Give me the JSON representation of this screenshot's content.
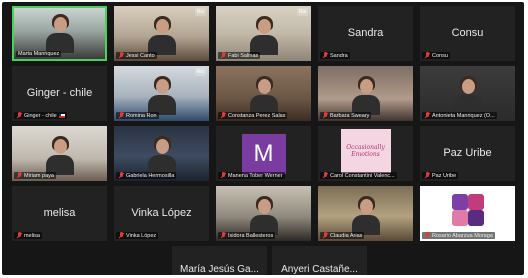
{
  "participants": [
    {
      "label": "Marta Manriquez",
      "center": "",
      "muted": false,
      "flag": false,
      "speaking": true,
      "logo": "",
      "style": "v1"
    },
    {
      "label": "Jessi Canto",
      "center": "",
      "muted": true,
      "flag": false,
      "speaking": false,
      "logo": "Ris",
      "style": "v2"
    },
    {
      "label": "Fabi Salinas",
      "center": "",
      "muted": true,
      "flag": false,
      "speaking": false,
      "logo": "Ris",
      "style": "v3"
    },
    {
      "label": "Sandra",
      "center": "Sandra",
      "muted": true,
      "flag": false,
      "speaking": false,
      "logo": "",
      "style": ""
    },
    {
      "label": "Consu",
      "center": "Consu",
      "muted": true,
      "flag": false,
      "speaking": false,
      "logo": "",
      "style": ""
    },
    {
      "label": "Ginger - chile",
      "center": "Ginger - chile",
      "muted": true,
      "flag": true,
      "speaking": false,
      "logo": "",
      "style": ""
    },
    {
      "label": "Romina Ron",
      "center": "",
      "muted": true,
      "flag": false,
      "speaking": false,
      "logo": "Ris",
      "style": "v4"
    },
    {
      "label": "Constanza Perez Salas",
      "center": "",
      "muted": true,
      "flag": false,
      "speaking": false,
      "logo": "",
      "style": "v5"
    },
    {
      "label": "Barbara Sweary",
      "center": "",
      "muted": true,
      "flag": false,
      "speaking": false,
      "logo": "",
      "style": "v6"
    },
    {
      "label": "Antonieta Manriquez (O...",
      "center": "",
      "muted": true,
      "flag": false,
      "speaking": false,
      "logo": "",
      "style": "v7"
    },
    {
      "label": "Miriam paya",
      "center": "",
      "muted": true,
      "flag": false,
      "speaking": false,
      "logo": "",
      "style": "v8"
    },
    {
      "label": "Gabriela Hermosilla",
      "center": "",
      "muted": true,
      "flag": false,
      "speaking": false,
      "logo": "",
      "style": "v9"
    },
    {
      "label": "Manena Tober Werner",
      "center": "",
      "muted": true,
      "flag": false,
      "speaking": false,
      "logo": "",
      "style": "m"
    },
    {
      "label": "Carol Constantini Valenc...",
      "center": "",
      "muted": true,
      "flag": false,
      "speaking": false,
      "logo": "",
      "style": "poster"
    },
    {
      "label": "Paz Uribe",
      "center": "Paz Uribe",
      "muted": true,
      "flag": false,
      "speaking": false,
      "logo": "",
      "style": ""
    },
    {
      "label": "melisa",
      "center": "melisa",
      "muted": true,
      "flag": false,
      "speaking": false,
      "logo": "",
      "style": ""
    },
    {
      "label": "Vinka López",
      "center": "Vinka López",
      "muted": true,
      "flag": false,
      "speaking": false,
      "logo": "",
      "style": ""
    },
    {
      "label": "Isidora Ballesteros",
      "center": "",
      "muted": true,
      "flag": false,
      "speaking": false,
      "logo": "",
      "style": "v10"
    },
    {
      "label": "Claudia Arias",
      "center": "",
      "muted": true,
      "flag": false,
      "speaking": false,
      "logo": "",
      "style": "v11"
    },
    {
      "label": "Rosario Abarzua Moraga",
      "center": "",
      "muted": true,
      "flag": false,
      "speaking": false,
      "logo": "",
      "style": "puzzle"
    }
  ],
  "bottom_row": [
    {
      "center": "María Jesús Ga..."
    },
    {
      "center": "Anyeri Castañe..."
    }
  ],
  "m_letter": "M",
  "poster_text": "Occasionally Emotions"
}
